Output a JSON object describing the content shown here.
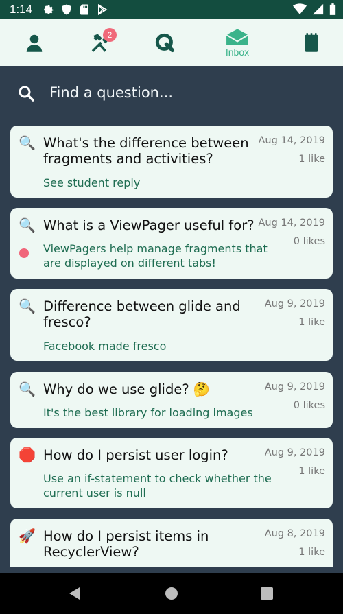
{
  "status_bar": {
    "time": "1:14"
  },
  "nav": {
    "profile": {
      "icon": "person-icon"
    },
    "tools": {
      "icon": "hammer-wrench-icon",
      "badge": "2"
    },
    "questions": {
      "icon": "q-icon"
    },
    "inbox": {
      "icon": "envelope-open-icon",
      "label": "Inbox"
    },
    "notes": {
      "icon": "notepad-icon"
    }
  },
  "search": {
    "placeholder": "Find a question..."
  },
  "questions": [
    {
      "icon": "🔍",
      "title": "What's the difference between fragments and activities?",
      "date": "Aug 14, 2019",
      "likes": "1 like",
      "reply": "See student reply",
      "unread": false
    },
    {
      "icon": "🔍",
      "title": "What is a ViewPager useful for?",
      "date": "Aug 14, 2019",
      "likes": "0 likes",
      "reply": "ViewPagers help manage fragments that are displayed on different tabs!",
      "unread": true
    },
    {
      "icon": "🔍",
      "title": "Difference between glide and fresco?",
      "date": "Aug 9, 2019",
      "likes": "1 like",
      "reply": "Facebook made fresco",
      "unread": false
    },
    {
      "icon": "🔍",
      "title": "Why do we use glide? 🤔",
      "date": "Aug 9, 2019",
      "likes": "0 likes",
      "reply": "It's the best library for loading images",
      "unread": false
    },
    {
      "icon": "🛑",
      "title": "How do I persist user login?",
      "date": "Aug 9, 2019",
      "likes": "1 like",
      "reply": "Use an if-statement to check whether the current user is null",
      "unread": false
    },
    {
      "icon": "🚀",
      "title": "How do I persist items in RecyclerView?",
      "date": "Aug 8, 2019",
      "likes": "1 like",
      "reply": "",
      "unread": false
    }
  ],
  "colors": {
    "status_bar": "#134d3f",
    "nav_bg": "#eef8f3",
    "nav_icon": "#16574a",
    "accent": "#3bb38a",
    "page_bg": "#2f3e4e",
    "card_bg": "#eef8f3",
    "reply_text": "#1f6d52",
    "badge": "#f06a7a"
  }
}
